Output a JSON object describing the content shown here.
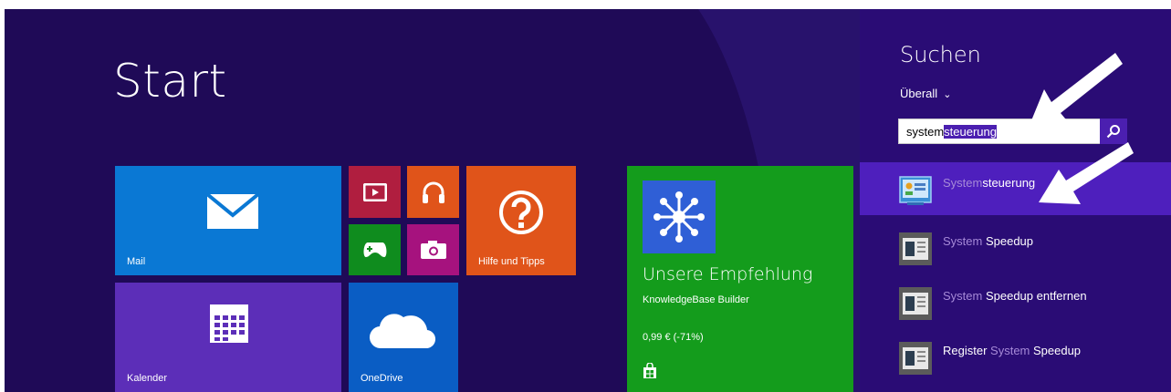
{
  "start": {
    "title": "Start"
  },
  "tiles": {
    "mail": {
      "label": "Mail",
      "color": "#0a78d4"
    },
    "calendar": {
      "label": "Kalender",
      "color": "#5c2eb8"
    },
    "video": {
      "color": "#b01e3f"
    },
    "music": {
      "color": "#e0541a"
    },
    "games": {
      "color": "#0f8c1e"
    },
    "camera": {
      "color": "#a6127e"
    },
    "help": {
      "label": "Hilfe und Tipps",
      "color": "#e0541a"
    },
    "onedrive": {
      "label": "OneDrive",
      "color": "#0a5dc4"
    },
    "store": {
      "heading": "Unsere Empfehlung",
      "app_name": "KnowledgeBase Builder",
      "price": "0,99 € (-71%)",
      "color": "#149c1c",
      "app_icon_color": "#2f5fd6"
    }
  },
  "search_charm": {
    "title": "Suchen",
    "scope": "Überall",
    "query_plain": "system",
    "query_selected": "steuerung",
    "results": [
      {
        "match": "System",
        "rest": "steuerung",
        "icon": "control-panel-icon",
        "selected": true
      },
      {
        "match": "System",
        "rest": " Speedup",
        "icon": "program-icon",
        "selected": false
      },
      {
        "match": "System",
        "rest": " Speedup entfernen",
        "icon": "program-icon",
        "selected": false
      },
      {
        "prefix": "Register ",
        "match": "System",
        "rest": " Speedup",
        "icon": "program-icon",
        "selected": false
      }
    ]
  },
  "colors": {
    "background": "#1f0a57",
    "charm": "#2a0c75",
    "accent": "#4b1fb0"
  }
}
